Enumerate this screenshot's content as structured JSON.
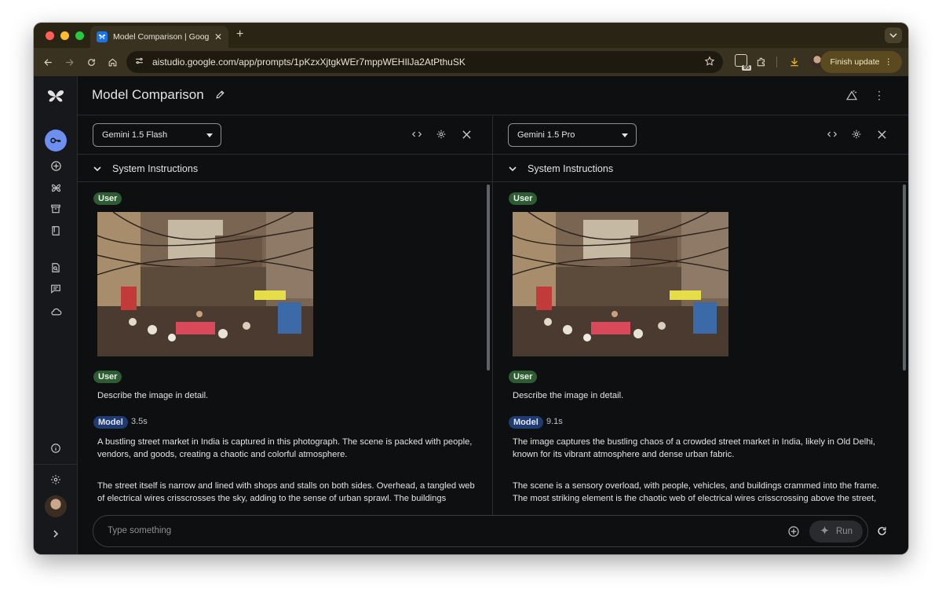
{
  "browser": {
    "tab_title": "Model Comparison | Google AI Studio",
    "url": "aistudio.google.com/app/prompts/1pKzxXjtgkWEr7mppWEHIlJa2AtPthuSK",
    "finish_update_label": "Finish update",
    "extension_badge": "95"
  },
  "app": {
    "page_title": "Model Comparison"
  },
  "panes": [
    {
      "model": "Gemini 1.5 Flash",
      "system_label": "System Instructions",
      "user_badge": "User",
      "user_badge_2": "User",
      "prompt": "Describe the image in detail.",
      "model_badge": "Model",
      "time": "3.5s",
      "para1": "A bustling street market in India is captured in this photograph. The scene is packed with people, vendors, and goods, creating a chaotic and colorful atmosphere.",
      "para2": "The street itself is narrow and lined with shops and stalls on both sides. Overhead, a tangled web of electrical wires crisscrosses the sky, adding to the sense of urban sprawl. The buildings"
    },
    {
      "model": "Gemini 1.5 Pro",
      "system_label": "System Instructions",
      "user_badge": "User",
      "user_badge_2": "User",
      "prompt": "Describe the image in detail.",
      "model_badge": "Model",
      "time": "9.1s",
      "para1": "The image captures the bustling chaos of a crowded street market in India, likely in Old Delhi, known for its vibrant atmosphere and dense urban fabric.",
      "para2": "The scene is a sensory overload, with people, vehicles, and buildings crammed into the frame. The most striking element is the chaotic web of electrical wires crisscrossing above the street,"
    }
  ],
  "input": {
    "placeholder": "Type something",
    "run_label": "Run"
  },
  "icons": [
    "back-icon",
    "forward-icon",
    "reload-icon",
    "home-icon",
    "site-info-icon",
    "star-icon",
    "extensions-icon",
    "download-icon",
    "more-icon",
    "key-icon",
    "add-circle-icon",
    "gallery-icon",
    "library-icon",
    "book-icon",
    "doc-search-icon",
    "chat-icon",
    "cloud-icon",
    "info-icon",
    "settings-icon",
    "expand-icon",
    "code-icon",
    "gear-icon",
    "close-icon",
    "chevron-down-icon",
    "sparkle-icon",
    "refresh-icon",
    "compare-icon"
  ],
  "colors": {
    "accent_key": "#6c8ff0",
    "user_badge": "#2e5a34",
    "model_badge": "#1f3b72",
    "finish_update": "#5b4a1f"
  }
}
